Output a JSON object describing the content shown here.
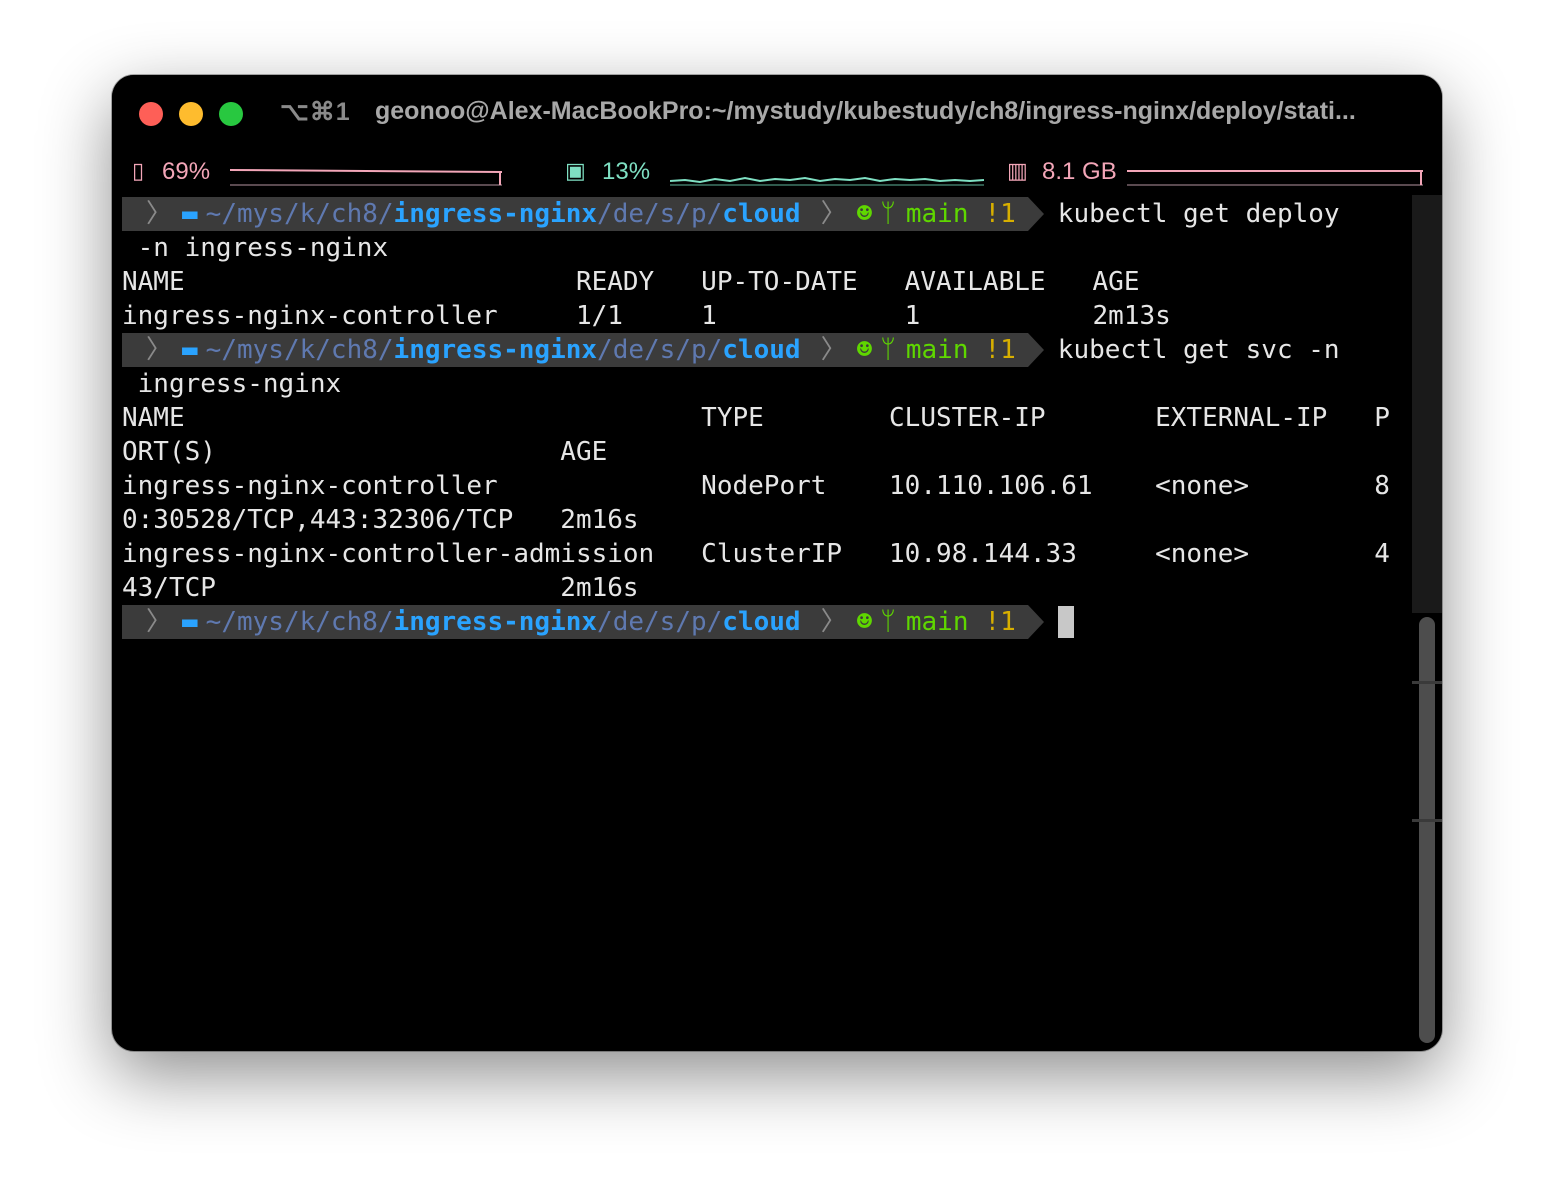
{
  "window": {
    "shortcut": "⌥⌘1",
    "title": "geonoo@Alex-MacBookPro:~/mystudy/kubestudy/ch8/ingress-nginx/deploy/stati..."
  },
  "status_bar": {
    "battery": "69%",
    "cpu": "13%",
    "memory": "8.1 GB",
    "colors": {
      "battery": "#f3a6b8",
      "cpu": "#7fe0c3",
      "memory": "#f3a6b8"
    }
  },
  "prompt": {
    "path_home": "~",
    "path_parts": [
      "mys",
      "k",
      "ch8",
      "ingress-nginx",
      "de",
      "s",
      "p",
      "cloud"
    ],
    "branch": "main",
    "git_status": "!1"
  },
  "terminal": {
    "cmd1_a": "kubectl get deploy",
    "cmd1_b": " -n ingress-nginx",
    "deploy_header": "NAME                         READY   UP-TO-DATE   AVAILABLE   AGE",
    "deploy_row": "ingress-nginx-controller     1/1     1            1           2m13s",
    "cmd2_a": "kubectl get svc -n",
    "cmd2_b": " ingress-nginx",
    "svc_header_1": "NAME                                 TYPE        CLUSTER-IP       EXTERNAL-IP   P",
    "svc_header_2": "ORT(S)                      AGE",
    "svc_row1_1": "ingress-nginx-controller             NodePort    10.110.106.61    <none>        8",
    "svc_row1_2": "0:30528/TCP,443:32306/TCP   2m16s",
    "svc_row2_1": "ingress-nginx-controller-admission   ClusterIP   10.98.144.33     <none>        4",
    "svc_row2_2": "43/TCP                      2m16s"
  }
}
